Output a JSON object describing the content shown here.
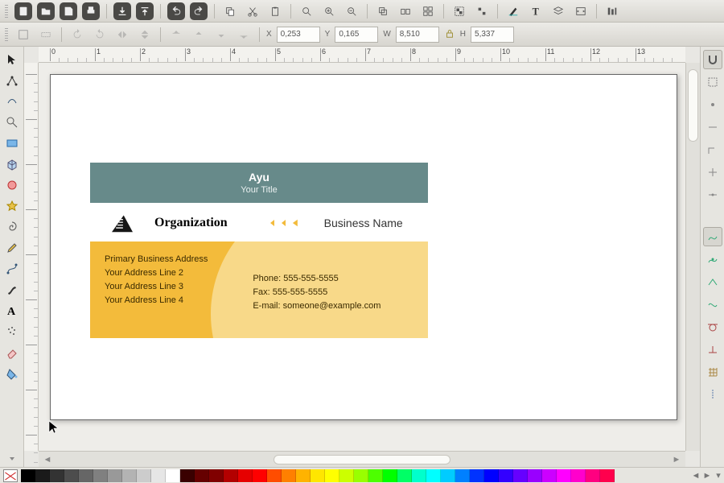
{
  "coords": {
    "x_label": "X",
    "x": "0,253",
    "y_label": "Y",
    "y": "0,165",
    "w_label": "W",
    "w": "8,510",
    "h_label": "H",
    "h": "5,337"
  },
  "ruler_h": [
    0,
    1,
    2,
    3,
    4,
    5,
    6,
    7,
    8,
    9,
    10,
    11,
    12,
    13
  ],
  "card": {
    "name": "Ayu",
    "title": "Your Title",
    "organization": "Organization",
    "business_name": "Business Name",
    "address": [
      "Primary Business Address",
      "Your Address Line 2",
      "Your Address Line 3",
      "Your Address Line 4"
    ],
    "contact": {
      "phone_label": "Phone:",
      "phone": "555-555-5555",
      "fax_label": "Fax:",
      "fax": "555-555-5555",
      "email_label": "E-mail:",
      "email": "someone@example.com"
    }
  },
  "palette": [
    "#000000",
    "#1a1a1a",
    "#333333",
    "#4d4d4d",
    "#666666",
    "#808080",
    "#999999",
    "#b3b3b3",
    "#cccccc",
    "#e6e6e6",
    "#ffffff",
    "#3a0000",
    "#660000",
    "#800000",
    "#b30000",
    "#e60000",
    "#ff0000",
    "#ff4d00",
    "#ff8000",
    "#ffb300",
    "#ffe600",
    "#ffff00",
    "#ccff00",
    "#99ff00",
    "#4dff00",
    "#00ff00",
    "#00ff66",
    "#00ffcc",
    "#00ffff",
    "#00ccff",
    "#0080ff",
    "#0033ff",
    "#0000ff",
    "#3300ff",
    "#6600ff",
    "#9900ff",
    "#cc00ff",
    "#ff00ff",
    "#ff00cc",
    "#ff0080",
    "#ff004d"
  ]
}
